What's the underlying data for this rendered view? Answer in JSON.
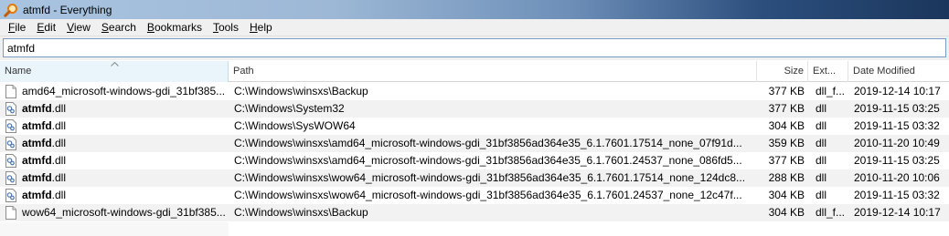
{
  "window": {
    "title": "atmfd - Everything",
    "icon": "magnifier-icon"
  },
  "menu": {
    "items": [
      {
        "first": "F",
        "rest": "ile"
      },
      {
        "first": "E",
        "rest": "dit"
      },
      {
        "first": "V",
        "rest": "iew"
      },
      {
        "first": "S",
        "rest": "earch"
      },
      {
        "first": "B",
        "rest": "ookmarks"
      },
      {
        "first": "T",
        "rest": "ools"
      },
      {
        "first": "H",
        "rest": "elp"
      }
    ]
  },
  "search": {
    "value": "atmfd"
  },
  "columns": {
    "name": "Name",
    "path": "Path",
    "size": "Size",
    "ext": "Ext...",
    "date": "Date Modified",
    "sort_indicator": "^"
  },
  "rows": [
    {
      "icon": "blank-file-icon",
      "name_bold": "",
      "name_rest": "amd64_microsoft-windows-gdi_31bf385...",
      "path": "C:\\Windows\\winsxs\\Backup",
      "size": "377 KB",
      "ext": "dll_f...",
      "date": "2019-12-14 10:17"
    },
    {
      "icon": "dll-file-icon",
      "name_bold": "atmfd",
      "name_rest": ".dll",
      "path": "C:\\Windows\\System32",
      "size": "377 KB",
      "ext": "dll",
      "date": "2019-11-15 03:25"
    },
    {
      "icon": "dll-file-icon",
      "name_bold": "atmfd",
      "name_rest": ".dll",
      "path": "C:\\Windows\\SysWOW64",
      "size": "304 KB",
      "ext": "dll",
      "date": "2019-11-15 03:32"
    },
    {
      "icon": "dll-file-icon",
      "name_bold": "atmfd",
      "name_rest": ".dll",
      "path": "C:\\Windows\\winsxs\\amd64_microsoft-windows-gdi_31bf3856ad364e35_6.1.7601.17514_none_07f91d...",
      "size": "359 KB",
      "ext": "dll",
      "date": "2010-11-20 10:49"
    },
    {
      "icon": "dll-file-icon",
      "name_bold": "atmfd",
      "name_rest": ".dll",
      "path": "C:\\Windows\\winsxs\\amd64_microsoft-windows-gdi_31bf3856ad364e35_6.1.7601.24537_none_086fd5...",
      "size": "377 KB",
      "ext": "dll",
      "date": "2019-11-15 03:25"
    },
    {
      "icon": "dll-file-icon",
      "name_bold": "atmfd",
      "name_rest": ".dll",
      "path": "C:\\Windows\\winsxs\\wow64_microsoft-windows-gdi_31bf3856ad364e35_6.1.7601.17514_none_124dc8...",
      "size": "288 KB",
      "ext": "dll",
      "date": "2010-11-20 10:06"
    },
    {
      "icon": "dll-file-icon",
      "name_bold": "atmfd",
      "name_rest": ".dll",
      "path": "C:\\Windows\\winsxs\\wow64_microsoft-windows-gdi_31bf3856ad364e35_6.1.7601.24537_none_12c47f...",
      "size": "304 KB",
      "ext": "dll",
      "date": "2019-11-15 03:32"
    },
    {
      "icon": "blank-file-icon",
      "name_bold": "",
      "name_rest": "wow64_microsoft-windows-gdi_31bf385...",
      "path": "C:\\Windows\\winsxs\\Backup",
      "size": "304 KB",
      "ext": "dll_f...",
      "date": "2019-12-14 10:17"
    }
  ],
  "colors": {
    "search_border": "#7a9cc6",
    "sorted_header": "#eaf4fb",
    "alt_row": "#f2f2f2"
  }
}
